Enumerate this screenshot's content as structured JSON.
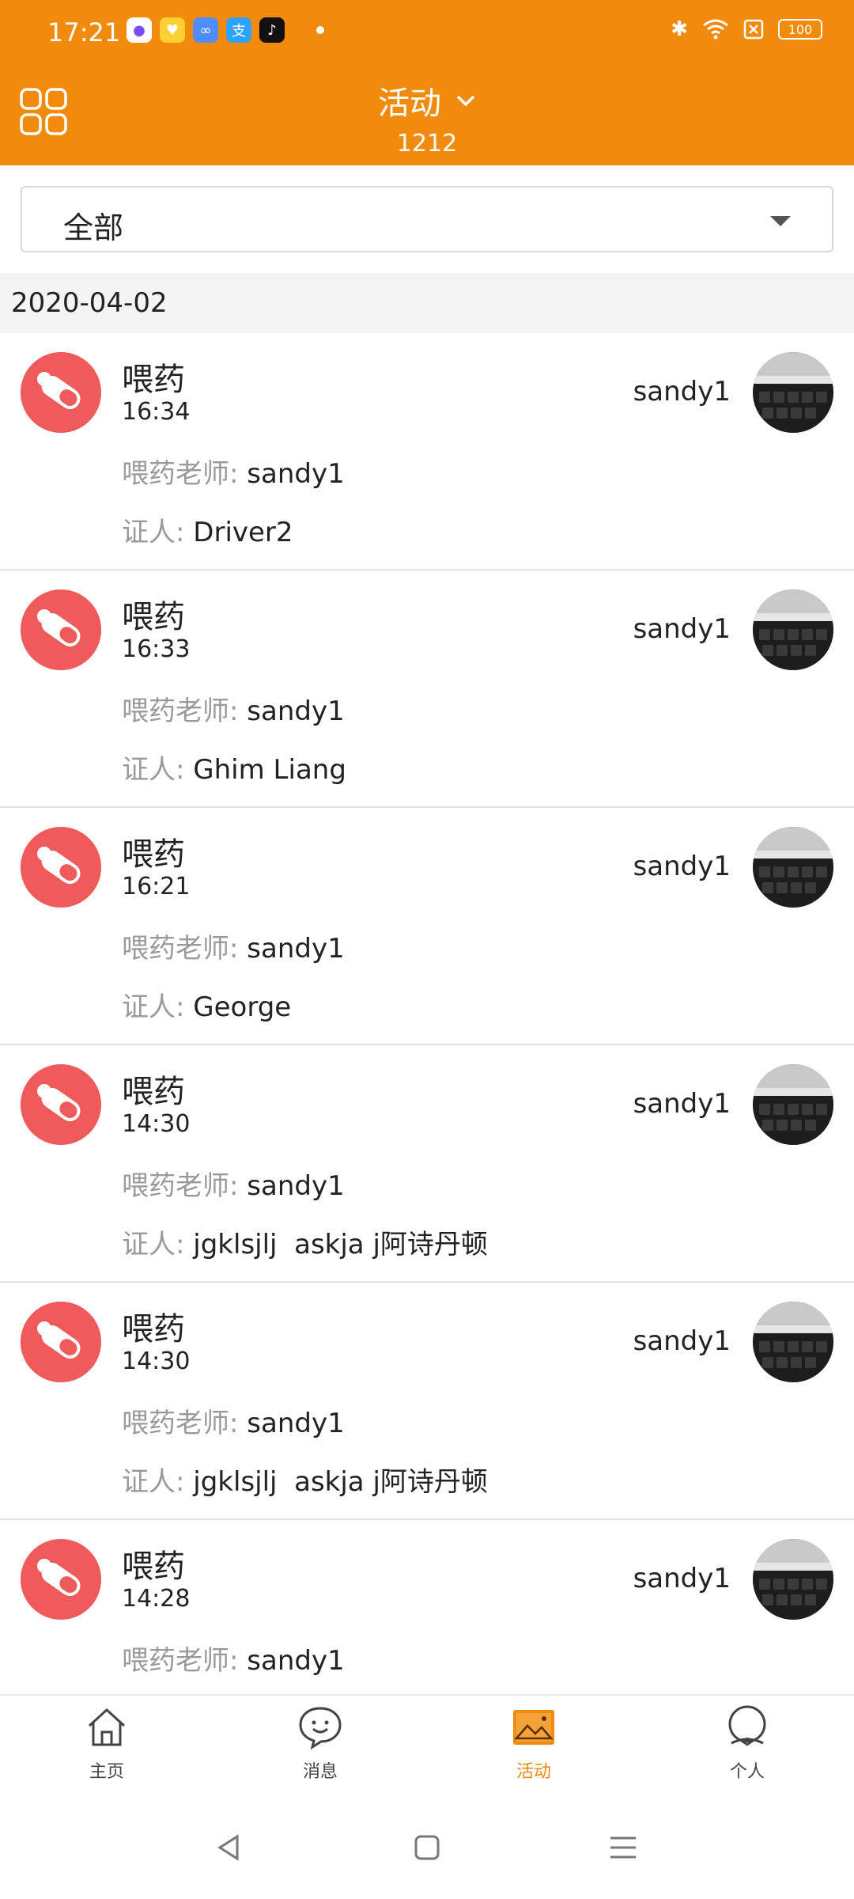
{
  "status_bar": {
    "time": "17:21",
    "battery": "100"
  },
  "header": {
    "title": "活动",
    "subtitle": "1212"
  },
  "filter": {
    "selected": "全部"
  },
  "date_group": "2020-04-02",
  "list": {
    "teacher_label": "喂药老师:",
    "witness_label": "证人:",
    "items": [
      {
        "title": "喂药",
        "time": "16:34",
        "teacher": "sandy1",
        "witness": "Driver2",
        "user": "sandy1"
      },
      {
        "title": "喂药",
        "time": "16:33",
        "teacher": "sandy1",
        "witness": "Ghim Liang",
        "user": "sandy1"
      },
      {
        "title": "喂药",
        "time": "16:21",
        "teacher": "sandy1",
        "witness": "George",
        "user": "sandy1"
      },
      {
        "title": "喂药",
        "time": "14:30",
        "teacher": "sandy1",
        "witness": "jgklsjlj  askja j阿诗丹顿",
        "user": "sandy1"
      },
      {
        "title": "喂药",
        "time": "14:30",
        "teacher": "sandy1",
        "witness": "jgklsjlj  askja j阿诗丹顿",
        "user": "sandy1"
      },
      {
        "title": "喂药",
        "time": "14:28",
        "teacher": "sandy1",
        "witness": "",
        "user": "sandy1"
      }
    ]
  },
  "bottom_nav": [
    {
      "label": "主页",
      "icon": "home-icon",
      "active": false
    },
    {
      "label": "消息",
      "icon": "chat-icon",
      "active": false
    },
    {
      "label": "活动",
      "icon": "gallery-icon",
      "active": true
    },
    {
      "label": "个人",
      "icon": "person-icon",
      "active": false
    }
  ],
  "colors": {
    "primary": "#F08B0E",
    "pill_icon_bg": "#EF5B5B",
    "label_gray": "#9a9a9a"
  }
}
